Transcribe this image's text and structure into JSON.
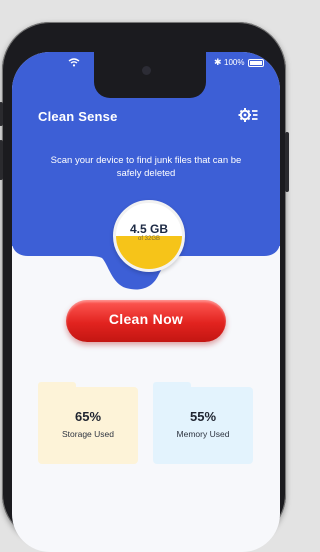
{
  "status_bar": {
    "battery_percent": "100%"
  },
  "app": {
    "title": "Clean Sense"
  },
  "header": {
    "subtitle": "Scan your device to find junk files that can be safely deleted"
  },
  "gauge": {
    "value": "4.5 GB",
    "total": "of 32GB",
    "fill_fraction": 0.5
  },
  "clean_button": {
    "label": "Clean Now"
  },
  "stats": {
    "storage": {
      "value": "65%",
      "label": "Storage Used"
    },
    "memory": {
      "value": "55%",
      "label": "Memory Used"
    }
  },
  "colors": {
    "header_blue": "#3d5fd6",
    "clean_red": "#e2231f",
    "gauge_yellow": "#f6c419",
    "storage_card": "#fdf3d8",
    "memory_card": "#e3f3fd"
  },
  "icons": {
    "settings": "settings-gear-icon",
    "wifi": "wifi-icon",
    "bluetooth": "bluetooth-icon",
    "battery": "battery-icon"
  }
}
